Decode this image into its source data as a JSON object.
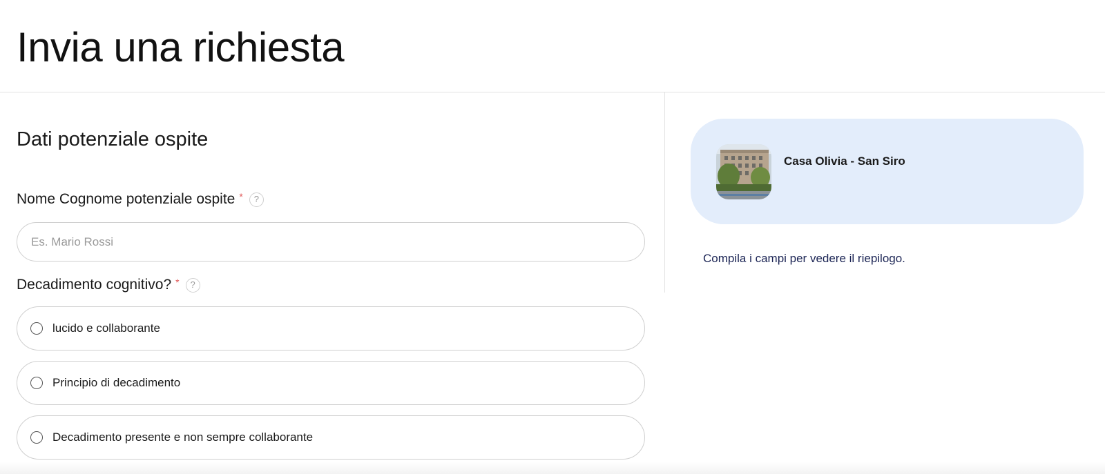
{
  "page": {
    "title": "Invia una richiesta"
  },
  "form": {
    "section_title": "Dati potenziale ospite",
    "name_field": {
      "label": "Nome Cognome potenziale ospite",
      "required_mark": "*",
      "help": "?",
      "placeholder": "Es. Mario Rossi",
      "value": ""
    },
    "cognitive_field": {
      "label": "Decadimento cognitivo?",
      "required_mark": "*",
      "help": "?",
      "options": [
        {
          "label": "lucido e collaborante",
          "selected": false
        },
        {
          "label": "Principio di decadimento",
          "selected": false
        },
        {
          "label": "Decadimento presente e non sempre collaborante",
          "selected": false
        }
      ]
    }
  },
  "summary": {
    "property": {
      "name": "Casa Olivia - San Siro",
      "thumbnail_icon": "building-photo"
    },
    "hint": "Compila i campi per vedere il riepilogo."
  },
  "colors": {
    "card_background": "#e3edfb",
    "required": "#e05757",
    "hint_text": "#1b2454",
    "border": "#cfcfcf"
  }
}
